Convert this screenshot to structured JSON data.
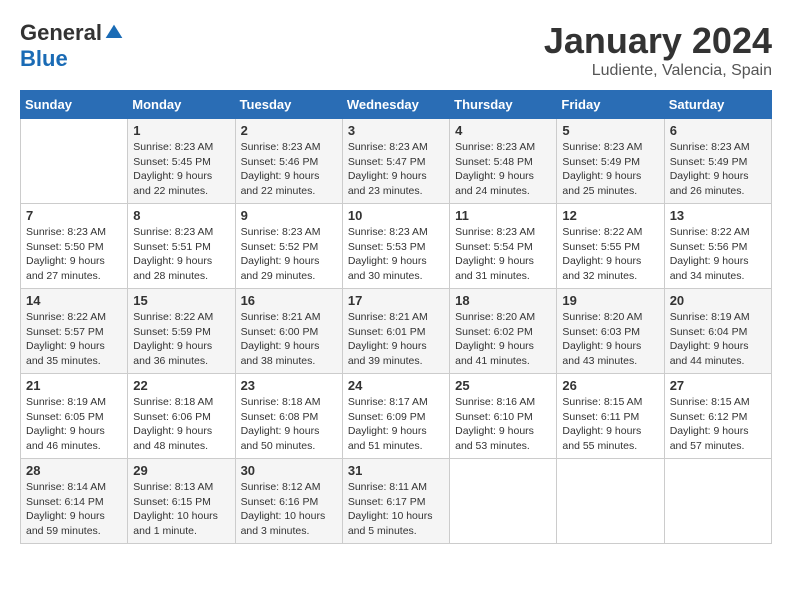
{
  "logo": {
    "general": "General",
    "blue": "Blue"
  },
  "title": "January 2024",
  "subtitle": "Ludiente, Valencia, Spain",
  "days_of_week": [
    "Sunday",
    "Monday",
    "Tuesday",
    "Wednesday",
    "Thursday",
    "Friday",
    "Saturday"
  ],
  "weeks": [
    [
      {
        "day": "",
        "sunrise": "",
        "sunset": "",
        "daylight": ""
      },
      {
        "day": "1",
        "sunrise": "Sunrise: 8:23 AM",
        "sunset": "Sunset: 5:45 PM",
        "daylight": "Daylight: 9 hours and 22 minutes."
      },
      {
        "day": "2",
        "sunrise": "Sunrise: 8:23 AM",
        "sunset": "Sunset: 5:46 PM",
        "daylight": "Daylight: 9 hours and 22 minutes."
      },
      {
        "day": "3",
        "sunrise": "Sunrise: 8:23 AM",
        "sunset": "Sunset: 5:47 PM",
        "daylight": "Daylight: 9 hours and 23 minutes."
      },
      {
        "day": "4",
        "sunrise": "Sunrise: 8:23 AM",
        "sunset": "Sunset: 5:48 PM",
        "daylight": "Daylight: 9 hours and 24 minutes."
      },
      {
        "day": "5",
        "sunrise": "Sunrise: 8:23 AM",
        "sunset": "Sunset: 5:49 PM",
        "daylight": "Daylight: 9 hours and 25 minutes."
      },
      {
        "day": "6",
        "sunrise": "Sunrise: 8:23 AM",
        "sunset": "Sunset: 5:49 PM",
        "daylight": "Daylight: 9 hours and 26 minutes."
      }
    ],
    [
      {
        "day": "7",
        "sunrise": "Sunrise: 8:23 AM",
        "sunset": "Sunset: 5:50 PM",
        "daylight": "Daylight: 9 hours and 27 minutes."
      },
      {
        "day": "8",
        "sunrise": "Sunrise: 8:23 AM",
        "sunset": "Sunset: 5:51 PM",
        "daylight": "Daylight: 9 hours and 28 minutes."
      },
      {
        "day": "9",
        "sunrise": "Sunrise: 8:23 AM",
        "sunset": "Sunset: 5:52 PM",
        "daylight": "Daylight: 9 hours and 29 minutes."
      },
      {
        "day": "10",
        "sunrise": "Sunrise: 8:23 AM",
        "sunset": "Sunset: 5:53 PM",
        "daylight": "Daylight: 9 hours and 30 minutes."
      },
      {
        "day": "11",
        "sunrise": "Sunrise: 8:23 AM",
        "sunset": "Sunset: 5:54 PM",
        "daylight": "Daylight: 9 hours and 31 minutes."
      },
      {
        "day": "12",
        "sunrise": "Sunrise: 8:22 AM",
        "sunset": "Sunset: 5:55 PM",
        "daylight": "Daylight: 9 hours and 32 minutes."
      },
      {
        "day": "13",
        "sunrise": "Sunrise: 8:22 AM",
        "sunset": "Sunset: 5:56 PM",
        "daylight": "Daylight: 9 hours and 34 minutes."
      }
    ],
    [
      {
        "day": "14",
        "sunrise": "Sunrise: 8:22 AM",
        "sunset": "Sunset: 5:57 PM",
        "daylight": "Daylight: 9 hours and 35 minutes."
      },
      {
        "day": "15",
        "sunrise": "Sunrise: 8:22 AM",
        "sunset": "Sunset: 5:59 PM",
        "daylight": "Daylight: 9 hours and 36 minutes."
      },
      {
        "day": "16",
        "sunrise": "Sunrise: 8:21 AM",
        "sunset": "Sunset: 6:00 PM",
        "daylight": "Daylight: 9 hours and 38 minutes."
      },
      {
        "day": "17",
        "sunrise": "Sunrise: 8:21 AM",
        "sunset": "Sunset: 6:01 PM",
        "daylight": "Daylight: 9 hours and 39 minutes."
      },
      {
        "day": "18",
        "sunrise": "Sunrise: 8:20 AM",
        "sunset": "Sunset: 6:02 PM",
        "daylight": "Daylight: 9 hours and 41 minutes."
      },
      {
        "day": "19",
        "sunrise": "Sunrise: 8:20 AM",
        "sunset": "Sunset: 6:03 PM",
        "daylight": "Daylight: 9 hours and 43 minutes."
      },
      {
        "day": "20",
        "sunrise": "Sunrise: 8:19 AM",
        "sunset": "Sunset: 6:04 PM",
        "daylight": "Daylight: 9 hours and 44 minutes."
      }
    ],
    [
      {
        "day": "21",
        "sunrise": "Sunrise: 8:19 AM",
        "sunset": "Sunset: 6:05 PM",
        "daylight": "Daylight: 9 hours and 46 minutes."
      },
      {
        "day": "22",
        "sunrise": "Sunrise: 8:18 AM",
        "sunset": "Sunset: 6:06 PM",
        "daylight": "Daylight: 9 hours and 48 minutes."
      },
      {
        "day": "23",
        "sunrise": "Sunrise: 8:18 AM",
        "sunset": "Sunset: 6:08 PM",
        "daylight": "Daylight: 9 hours and 50 minutes."
      },
      {
        "day": "24",
        "sunrise": "Sunrise: 8:17 AM",
        "sunset": "Sunset: 6:09 PM",
        "daylight": "Daylight: 9 hours and 51 minutes."
      },
      {
        "day": "25",
        "sunrise": "Sunrise: 8:16 AM",
        "sunset": "Sunset: 6:10 PM",
        "daylight": "Daylight: 9 hours and 53 minutes."
      },
      {
        "day": "26",
        "sunrise": "Sunrise: 8:15 AM",
        "sunset": "Sunset: 6:11 PM",
        "daylight": "Daylight: 9 hours and 55 minutes."
      },
      {
        "day": "27",
        "sunrise": "Sunrise: 8:15 AM",
        "sunset": "Sunset: 6:12 PM",
        "daylight": "Daylight: 9 hours and 57 minutes."
      }
    ],
    [
      {
        "day": "28",
        "sunrise": "Sunrise: 8:14 AM",
        "sunset": "Sunset: 6:14 PM",
        "daylight": "Daylight: 9 hours and 59 minutes."
      },
      {
        "day": "29",
        "sunrise": "Sunrise: 8:13 AM",
        "sunset": "Sunset: 6:15 PM",
        "daylight": "Daylight: 10 hours and 1 minute."
      },
      {
        "day": "30",
        "sunrise": "Sunrise: 8:12 AM",
        "sunset": "Sunset: 6:16 PM",
        "daylight": "Daylight: 10 hours and 3 minutes."
      },
      {
        "day": "31",
        "sunrise": "Sunrise: 8:11 AM",
        "sunset": "Sunset: 6:17 PM",
        "daylight": "Daylight: 10 hours and 5 minutes."
      },
      {
        "day": "",
        "sunrise": "",
        "sunset": "",
        "daylight": ""
      },
      {
        "day": "",
        "sunrise": "",
        "sunset": "",
        "daylight": ""
      },
      {
        "day": "",
        "sunrise": "",
        "sunset": "",
        "daylight": ""
      }
    ]
  ]
}
